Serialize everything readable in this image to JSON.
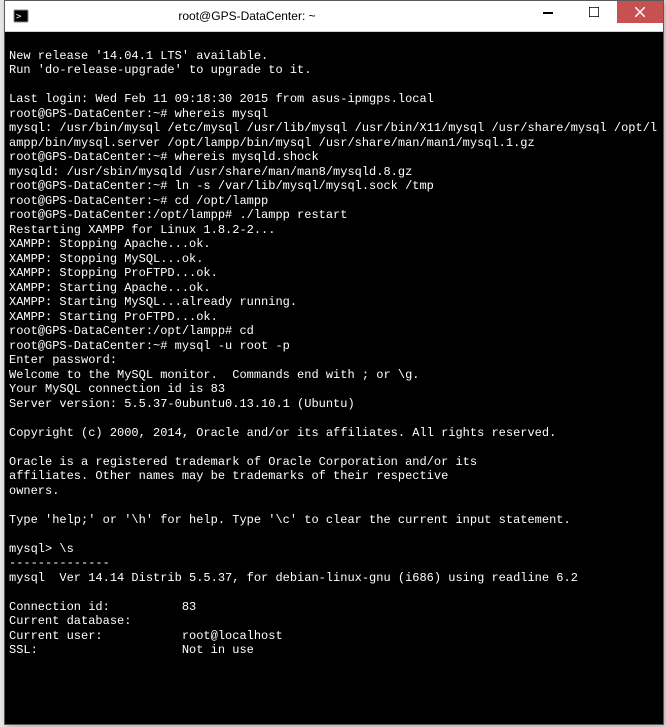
{
  "window": {
    "title": "root@GPS-DataCenter: ~"
  },
  "terminal": {
    "content": "\nNew release '14.04.1 LTS' available.\nRun 'do-release-upgrade' to upgrade to it.\n\nLast login: Wed Feb 11 09:18:30 2015 from asus-ipmgps.local\nroot@GPS-DataCenter:~# whereis mysql\nmysql: /usr/bin/mysql /etc/mysql /usr/lib/mysql /usr/bin/X11/mysql /usr/share/mysql /opt/lampp/bin/mysql.server /opt/lampp/bin/mysql /usr/share/man/man1/mysql.1.gz\nroot@GPS-DataCenter:~# whereis mysqld.shock\nmysqld: /usr/sbin/mysqld /usr/share/man/man8/mysqld.8.gz\nroot@GPS-DataCenter:~# ln -s /var/lib/mysql/mysql.sock /tmp\nroot@GPS-DataCenter:~# cd /opt/lampp\nroot@GPS-DataCenter:/opt/lampp# ./lampp restart\nRestarting XAMPP for Linux 1.8.2-2...\nXAMPP: Stopping Apache...ok.\nXAMPP: Stopping MySQL...ok.\nXAMPP: Stopping ProFTPD...ok.\nXAMPP: Starting Apache...ok.\nXAMPP: Starting MySQL...already running.\nXAMPP: Starting ProFTPD...ok.\nroot@GPS-DataCenter:/opt/lampp# cd\nroot@GPS-DataCenter:~# mysql -u root -p\nEnter password:\nWelcome to the MySQL monitor.  Commands end with ; or \\g.\nYour MySQL connection id is 83\nServer version: 5.5.37-0ubuntu0.13.10.1 (Ubuntu)\n\nCopyright (c) 2000, 2014, Oracle and/or its affiliates. All rights reserved.\n\nOracle is a registered trademark of Oracle Corporation and/or its\naffiliates. Other names may be trademarks of their respective\nowners.\n\nType 'help;' or '\\h' for help. Type '\\c' to clear the current input statement.\n\nmysql> \\s\n--------------\nmysql  Ver 14.14 Distrib 5.5.37, for debian-linux-gnu (i686) using readline 6.2\n\nConnection id:          83\nCurrent database:\nCurrent user:           root@localhost\nSSL:                    Not in use"
  }
}
